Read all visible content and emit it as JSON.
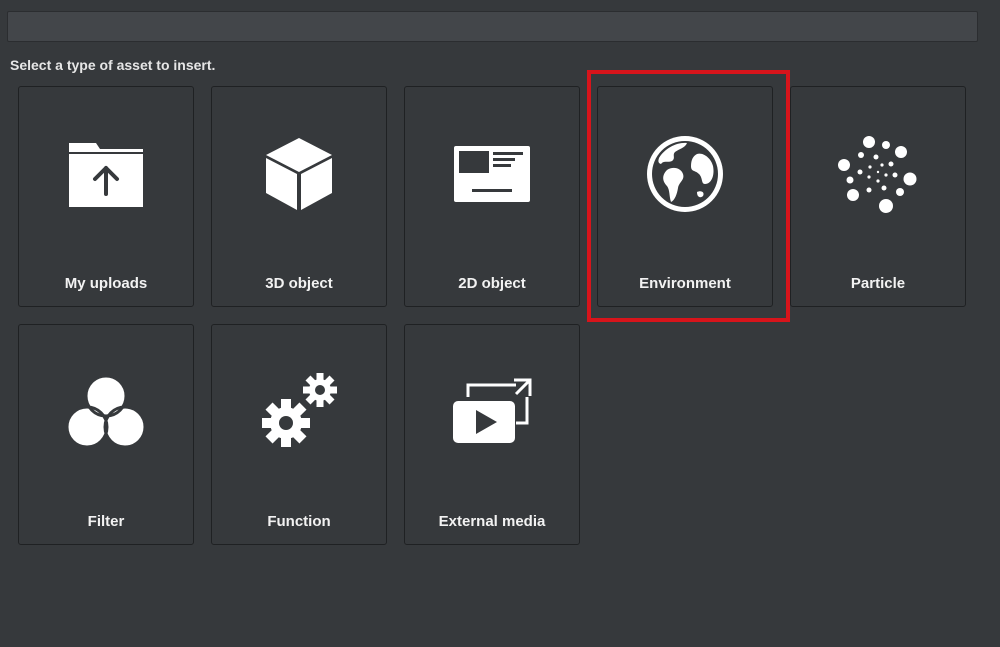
{
  "search": {
    "value": "",
    "placeholder": ""
  },
  "instruction": "Select a type of asset to insert.",
  "tiles": [
    {
      "label": "My uploads",
      "icon": "folder-upload-icon"
    },
    {
      "label": "3D object",
      "icon": "cube-icon"
    },
    {
      "label": "2D object",
      "icon": "image-card-icon"
    },
    {
      "label": "Environment",
      "icon": "globe-icon",
      "highlighted": true
    },
    {
      "label": "Particle",
      "icon": "particle-burst-icon"
    },
    {
      "label": "Filter",
      "icon": "color-circles-icon"
    },
    {
      "label": "Function",
      "icon": "gears-icon"
    },
    {
      "label": "External media",
      "icon": "external-media-icon"
    }
  ],
  "colors": {
    "background": "#36393c",
    "tile_border": "#1f2123",
    "icon": "#ffffff",
    "highlight": "#d7141b"
  }
}
